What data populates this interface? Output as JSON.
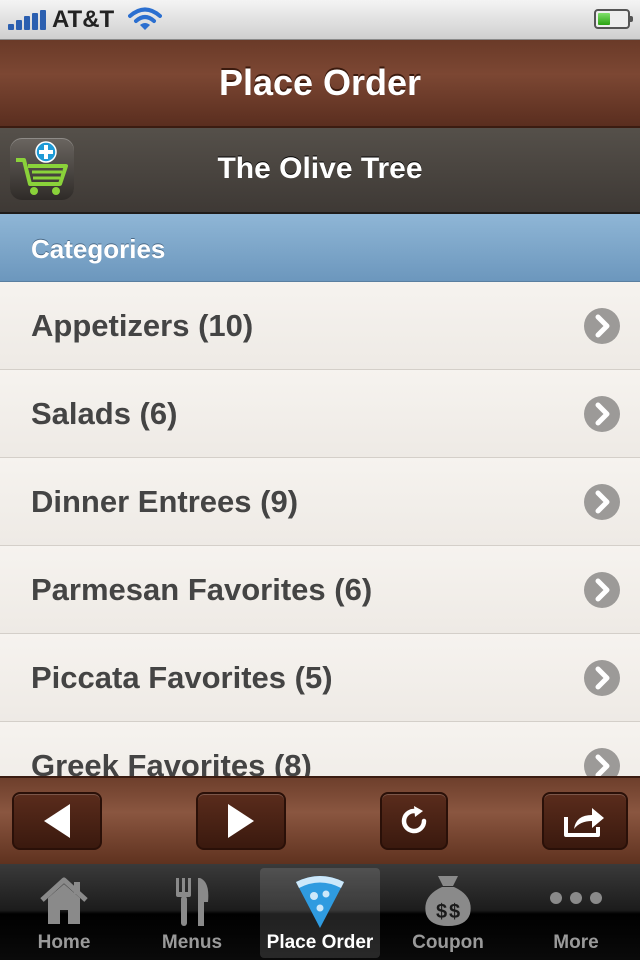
{
  "status": {
    "carrier": "AT&T"
  },
  "header": {
    "title": "Place Order"
  },
  "restaurant": {
    "name": "The Olive Tree"
  },
  "categories": {
    "header": "Categories",
    "items": [
      "Appetizers (10)",
      "Salads (6)",
      "Dinner Entrees (9)",
      "Parmesan Favorites (6)",
      "Piccata Favorites (5)",
      "Greek Favorites (8)"
    ]
  },
  "tabs": [
    {
      "label": "Home"
    },
    {
      "label": "Menus"
    },
    {
      "label": "Place Order"
    },
    {
      "label": "Coupon"
    },
    {
      "label": "More"
    }
  ],
  "colors": {
    "brown": "#6a3a28",
    "category_blue": "#7aa3c7",
    "tab_active_bg": "#3a3a3a"
  }
}
